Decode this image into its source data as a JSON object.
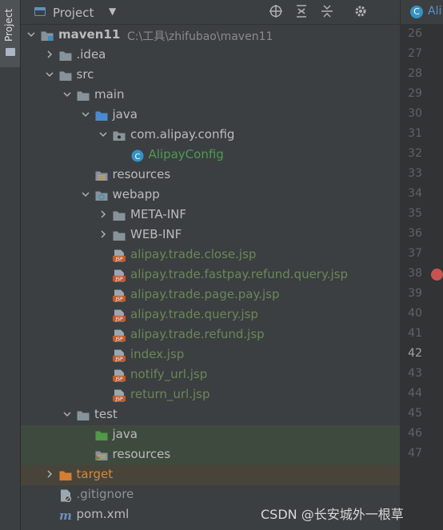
{
  "tool_strip": {
    "tab_label": "Project"
  },
  "panel": {
    "title": "Project",
    "header_buttons": [
      "locate-icon",
      "expand-all-icon",
      "collapse-all-icon",
      "settings-icon"
    ]
  },
  "editor_tab": {
    "label": "Ali"
  },
  "tree": [
    {
      "label": "maven11",
      "path": "C:\\工具\\zhifubao\\maven11",
      "icon": "module-folder-icon",
      "depth": 0,
      "chevron": "down",
      "style": "bold"
    },
    {
      "label": ".idea",
      "icon": "folder-icon",
      "depth": 1,
      "chevron": "right"
    },
    {
      "label": "src",
      "icon": "folder-icon",
      "depth": 1,
      "chevron": "down"
    },
    {
      "label": "main",
      "icon": "folder-icon",
      "depth": 2,
      "chevron": "down"
    },
    {
      "label": "java",
      "icon": "source-folder-icon",
      "depth": 3,
      "chevron": "down"
    },
    {
      "label": "com.alipay.config",
      "icon": "package-icon",
      "depth": 4,
      "chevron": "down"
    },
    {
      "label": "AlipayConfig",
      "icon": "class-icon",
      "depth": 5,
      "chevron": "none",
      "style": "cls"
    },
    {
      "label": "resources",
      "icon": "resources-folder-icon",
      "depth": 3,
      "chevron": "none"
    },
    {
      "label": "webapp",
      "icon": "web-folder-icon",
      "depth": 3,
      "chevron": "down"
    },
    {
      "label": "META-INF",
      "icon": "folder-icon",
      "depth": 4,
      "chevron": "right"
    },
    {
      "label": "WEB-INF",
      "icon": "folder-icon",
      "depth": 4,
      "chevron": "right"
    },
    {
      "label": "alipay.trade.close.jsp",
      "icon": "jsp-file-icon",
      "depth": 4,
      "chevron": "none",
      "style": "jsp"
    },
    {
      "label": "alipay.trade.fastpay.refund.query.jsp",
      "icon": "jsp-file-icon",
      "depth": 4,
      "chevron": "none",
      "style": "jsp"
    },
    {
      "label": "alipay.trade.page.pay.jsp",
      "icon": "jsp-file-icon",
      "depth": 4,
      "chevron": "none",
      "style": "jsp"
    },
    {
      "label": "alipay.trade.query.jsp",
      "icon": "jsp-file-icon",
      "depth": 4,
      "chevron": "none",
      "style": "jsp"
    },
    {
      "label": "alipay.trade.refund.jsp",
      "icon": "jsp-file-icon",
      "depth": 4,
      "chevron": "none",
      "style": "jsp"
    },
    {
      "label": "index.jsp",
      "icon": "jsp-file-icon",
      "depth": 4,
      "chevron": "none",
      "style": "jsp"
    },
    {
      "label": "notify_url.jsp",
      "icon": "jsp-file-icon",
      "depth": 4,
      "chevron": "none",
      "style": "jsp"
    },
    {
      "label": "return_url.jsp",
      "icon": "jsp-file-icon",
      "depth": 4,
      "chevron": "none",
      "style": "jsp"
    },
    {
      "label": "test",
      "icon": "folder-icon",
      "depth": 2,
      "chevron": "down"
    },
    {
      "label": "java",
      "icon": "test-source-folder-icon",
      "depth": 3,
      "chevron": "none",
      "highlight": "green"
    },
    {
      "label": "resources",
      "icon": "test-resources-folder-icon",
      "depth": 3,
      "chevron": "none",
      "highlight": "green"
    },
    {
      "label": "target",
      "icon": "excluded-folder-icon",
      "depth": 1,
      "chevron": "right",
      "style": "orange",
      "highlight": "orange"
    },
    {
      "label": ".gitignore",
      "icon": "ignore-file-icon",
      "depth": 1,
      "chevron": "none",
      "style": "gitignore"
    },
    {
      "label": "pom.xml",
      "icon": "maven-icon",
      "depth": 1,
      "chevron": "none"
    }
  ],
  "gutter": {
    "line_numbers": [
      "26",
      "27",
      "28",
      "29",
      "30",
      "31",
      "32",
      "33",
      "34",
      "35",
      "36",
      "37",
      "38",
      "39",
      "40",
      "41",
      "42",
      "43",
      "44",
      "45",
      "46",
      "47"
    ],
    "current_line": "42",
    "breakpoint_line": "38"
  },
  "watermark": "CSDN @长安城外一根草",
  "colors": {
    "background": "#2b2b2b",
    "panel": "#3c3f41",
    "jsp_text": "#6a8759",
    "class_text": "#4e9a55",
    "excluded_text": "#d08b3e",
    "breakpoint": "#c75450",
    "folder": "#87939a",
    "source_folder": "#4b8ad0",
    "test_folder": "#4f9a45",
    "excluded_folder": "#d47e33"
  }
}
